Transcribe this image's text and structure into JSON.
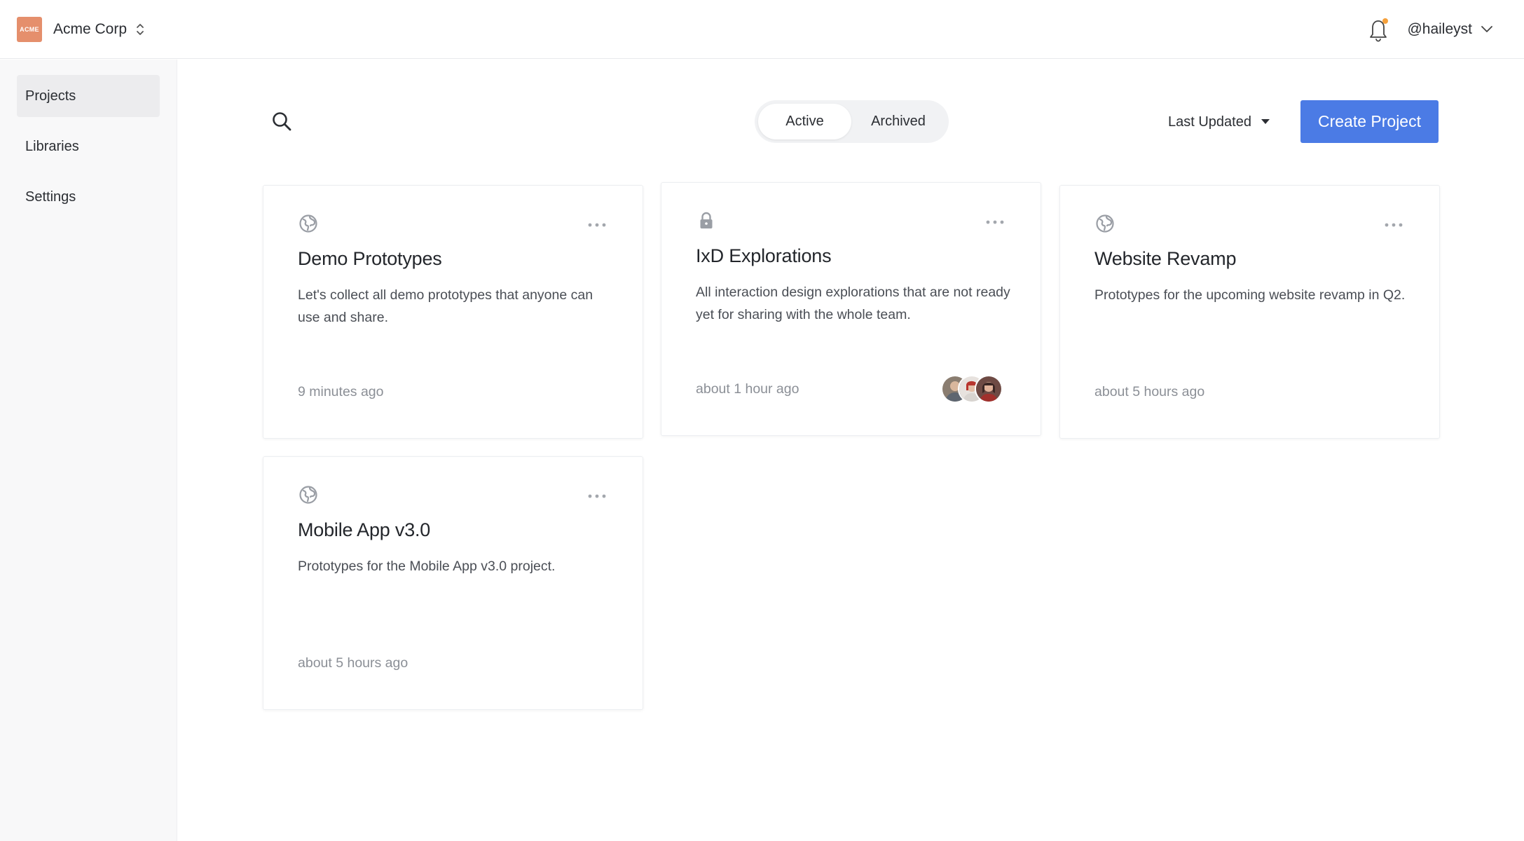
{
  "org": {
    "logo_text": "ACME",
    "name": "Acme Corp"
  },
  "user": {
    "handle": "@haileyst"
  },
  "sidebar": {
    "items": [
      {
        "label": "Projects",
        "active": true
      },
      {
        "label": "Libraries",
        "active": false
      },
      {
        "label": "Settings",
        "active": false
      }
    ]
  },
  "toolbar": {
    "tabs": [
      {
        "label": "Active",
        "active": true
      },
      {
        "label": "Archived",
        "active": false
      }
    ],
    "sort_label": "Last Updated",
    "create_label": "Create Project"
  },
  "projects": [
    {
      "title": "Demo Prototypes",
      "description": "Let's collect all demo prototypes that anyone can use and share.",
      "updated": "9 minutes ago",
      "visibility": "globe-icon"
    },
    {
      "title": "IxD Explorations",
      "description": "All interaction design explorations that are not ready yet for sharing with the whole team.",
      "updated": "about 1 hour ago",
      "visibility": "lock-icon",
      "member_count": 3
    },
    {
      "title": "Website Revamp",
      "description": "Prototypes for the upcoming website revamp in Q2.",
      "updated": "about 5 hours ago",
      "visibility": "globe-icon"
    },
    {
      "title": "Mobile App v3.0",
      "description": "Prototypes for the Mobile App v3.0 project.",
      "updated": "about 5 hours ago",
      "visibility": "globe-icon"
    }
  ],
  "colors": {
    "primary": "#4b7be5",
    "notification_dot": "#f5a13c",
    "logo_bg": "#e58f6c"
  }
}
